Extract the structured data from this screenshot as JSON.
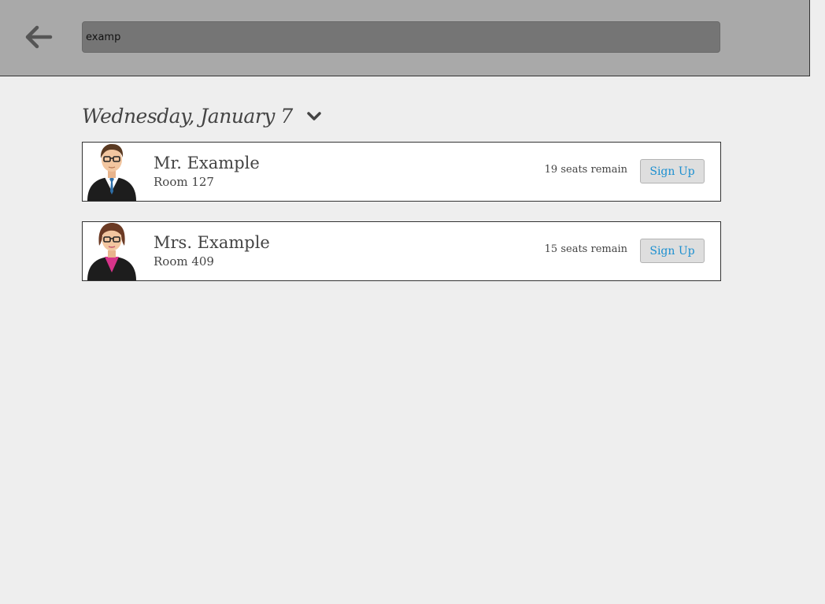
{
  "header": {
    "back_icon": "arrow-left-icon",
    "search_value": "examp"
  },
  "date_selector": {
    "label": "Wednesday, January 7",
    "icon": "chevron-down-icon"
  },
  "teachers": [
    {
      "name": "Mr. Example",
      "room": "Room 127",
      "seats": "19 seats remain",
      "button": "Sign Up",
      "avatar": "male-teacher-avatar"
    },
    {
      "name": "Mrs. Example",
      "room": "Room 409",
      "seats": "15 seats remain",
      "button": "Sign Up",
      "avatar": "female-teacher-avatar"
    }
  ],
  "colors": {
    "background": "#eeeeee",
    "header_bg": "#a9a9a9",
    "search_bg": "#757575",
    "link_blue": "#1b8fd0"
  }
}
